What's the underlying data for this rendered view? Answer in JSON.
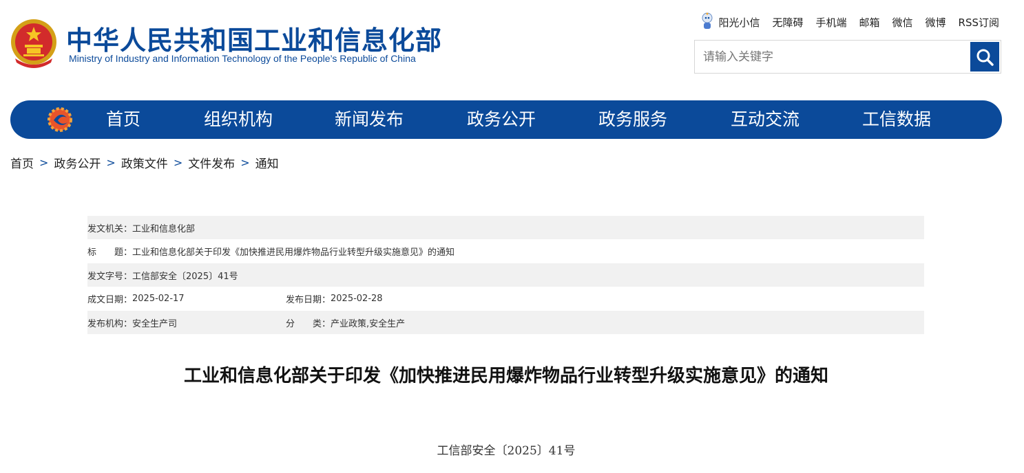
{
  "header": {
    "site_title_cn": "中华人民共和国工业和信息化部",
    "site_title_en": "Ministry of Industry and Information Technology of the People’s Republic of China",
    "top_links": [
      "阳光小信",
      "无障碍",
      "手机端",
      "邮箱",
      "微信",
      "微博",
      "RSS订阅"
    ],
    "search": {
      "placeholder": "请输入关键字",
      "icon": "search-icon"
    }
  },
  "nav": {
    "items": [
      "首页",
      "组织机构",
      "新闻发布",
      "政务公开",
      "政务服务",
      "互动交流",
      "工信数据"
    ]
  },
  "breadcrumb": [
    "首页",
    "政务公开",
    "政策文件",
    "文件发布",
    "通知"
  ],
  "info": {
    "issuer_label": "发文机关：",
    "issuer": "工业和信息化部",
    "title_label": "标　　题：",
    "title": "工业和信息化部关于印发《加快推进民用爆炸物品行业转型升级实施意见》的通知",
    "doc_no_label": "发文字号：",
    "doc_no": "工信部安全〔2025〕41号",
    "written_label": "成文日期：",
    "written_date": "2025-02-17",
    "published_label": "发布日期：",
    "published_date": "2025-02-28",
    "org_label": "发布机构：",
    "org": "安全生产司",
    "category_label": "分　　类：",
    "category": "产业政策,安全生产"
  },
  "article": {
    "title": "工业和信息化部关于印发《加快推进民用爆炸物品行业转型升级实施意见》的通知",
    "doc_no": "工信部安全〔2025〕41号"
  },
  "colors": {
    "brand": "#0b4a9a",
    "row_alt": "#f1f1f1"
  }
}
